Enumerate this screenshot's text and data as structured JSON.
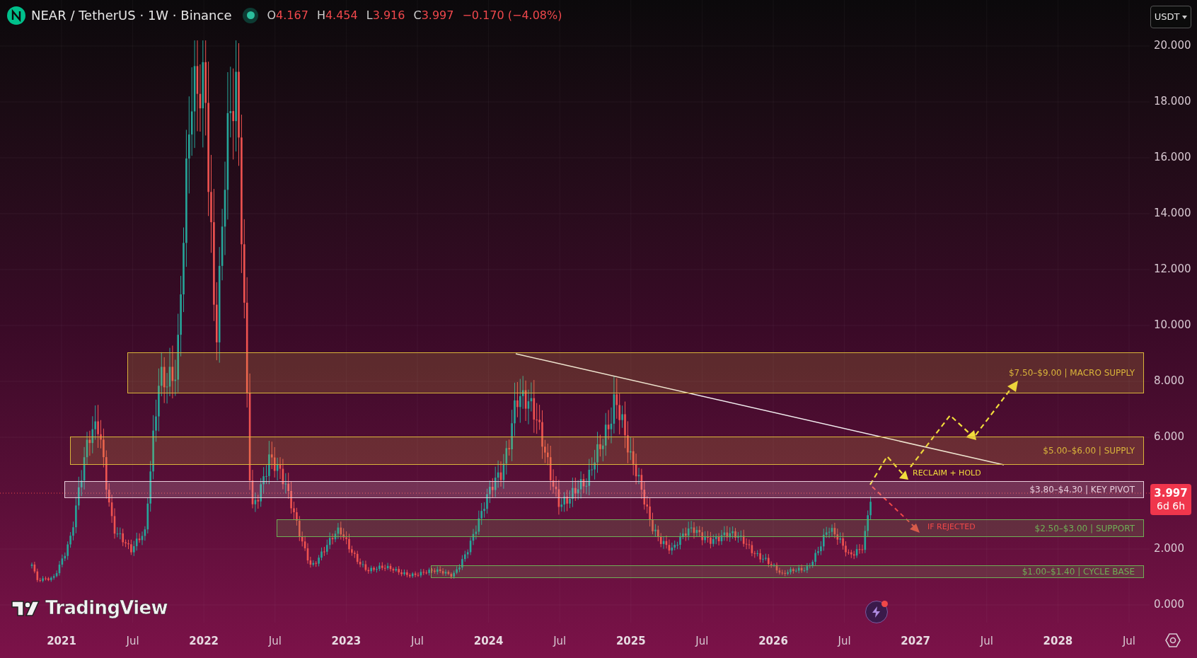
{
  "header": {
    "symbol": "NEAR / TetherUS · 1W · Binance",
    "ohlc": [
      {
        "label": "O",
        "value": "4.167"
      },
      {
        "label": "H",
        "value": "4.454"
      },
      {
        "label": "L",
        "value": "3.916"
      },
      {
        "label": "C",
        "value": "3.997"
      }
    ],
    "change": "−0.170 (−4.08%)"
  },
  "currency": "USDT",
  "zones": [
    {
      "label": "$7.50–$9.00 | MACRO SUPPLY",
      "color": "#d9b43a"
    },
    {
      "label": "$5.00–$6.00 | SUPPLY",
      "color": "#d9b43a"
    },
    {
      "label": "$3.80–$4.30 | KEY PIVOT",
      "color": "#e8cddb"
    },
    {
      "label": "$2.50–$3.00 | SUPPORT",
      "color": "#6fae55"
    },
    {
      "label": "$1.00–$1.40 | CYCLE BASE",
      "color": "#6fae55"
    }
  ],
  "annotations": [
    {
      "text": "RECLAIM + HOLD",
      "color": "#f2dd3c"
    },
    {
      "text": "IF REJECTED",
      "color": "#f04848"
    }
  ],
  "price_axis": [
    "20.000",
    "18.000",
    "16.000",
    "14.000",
    "12.000",
    "10.000",
    "8.000",
    "6.000",
    "2.000",
    "0.000"
  ],
  "last_price": {
    "price": "3.997",
    "countdown": "6d 6h"
  },
  "time_axis": [
    {
      "text": "2021",
      "major": true
    },
    {
      "text": "Jul",
      "major": false
    },
    {
      "text": "2022",
      "major": true
    },
    {
      "text": "Jul",
      "major": false
    },
    {
      "text": "2023",
      "major": true
    },
    {
      "text": "Jul",
      "major": false
    },
    {
      "text": "2024",
      "major": true
    },
    {
      "text": "Jul",
      "major": false
    },
    {
      "text": "2025",
      "major": true
    },
    {
      "text": "Jul",
      "major": false
    },
    {
      "text": "2026",
      "major": true
    },
    {
      "text": "Jul",
      "major": false
    },
    {
      "text": "2027",
      "major": true
    },
    {
      "text": "Jul",
      "major": false
    },
    {
      "text": "2028",
      "major": true
    },
    {
      "text": "Jul",
      "major": false
    }
  ],
  "logo": "TradingView"
}
